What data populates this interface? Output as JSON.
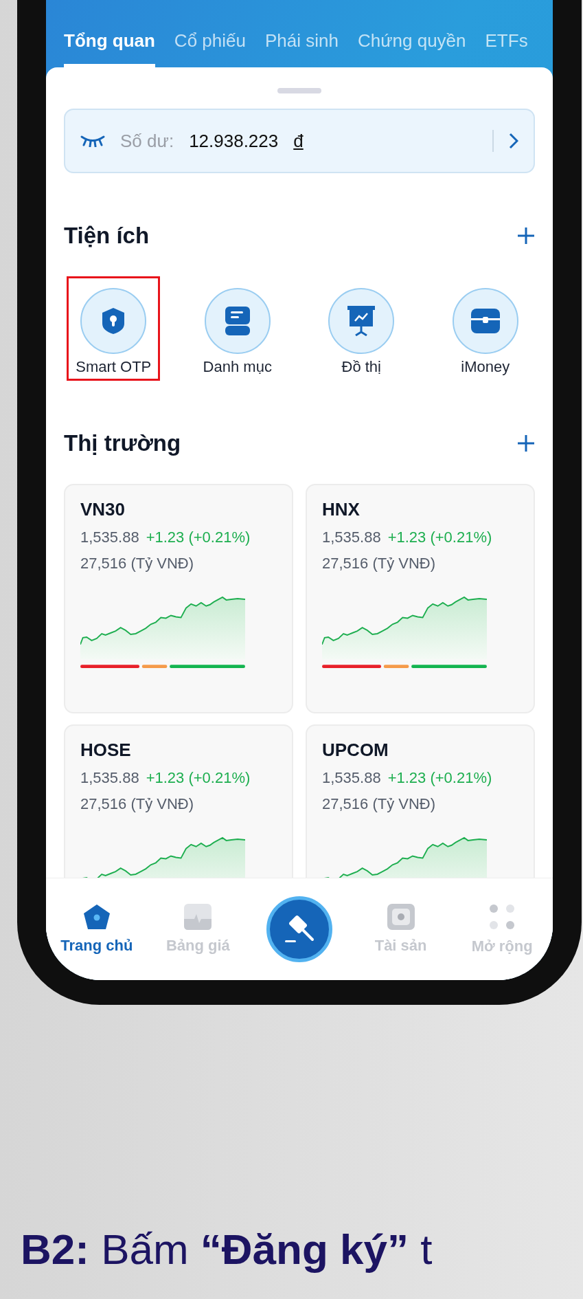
{
  "tabs": [
    {
      "label": "Tổng quan",
      "selected": true
    },
    {
      "label": "Cổ phiếu",
      "selected": false
    },
    {
      "label": "Phái sinh",
      "selected": false
    },
    {
      "label": "Chứng quyền",
      "selected": false
    },
    {
      "label": "ETFs",
      "selected": false
    }
  ],
  "balance": {
    "label": "Số dư:",
    "value": "12.938.223",
    "currency": "đ"
  },
  "utilities": {
    "title": "Tiện ích",
    "items": [
      {
        "label": "Smart OTP",
        "highlighted": true
      },
      {
        "label": "Danh mục",
        "highlighted": false
      },
      {
        "label": "Đồ thị",
        "highlighted": false
      },
      {
        "label": "iMoney",
        "highlighted": false
      }
    ]
  },
  "market": {
    "title": "Thị trường",
    "cards": [
      {
        "name": "VN30",
        "price": "1,535.88",
        "change": "+1.23 (+0.21%)",
        "volume": "27,516 (Tỷ VNĐ)"
      },
      {
        "name": "HNX",
        "price": "1,535.88",
        "change": "+1.23 (+0.21%)",
        "volume": "27,516 (Tỷ VNĐ)"
      },
      {
        "name": "HOSE",
        "price": "1,535.88",
        "change": "+1.23 (+0.21%)",
        "volume": "27,516 (Tỷ VNĐ)"
      },
      {
        "name": "UPCOM",
        "price": "1,535.88",
        "change": "+1.23 (+0.21%)",
        "volume": "27,516 (Tỷ VNĐ)"
      }
    ]
  },
  "bottom_nav": [
    {
      "label": "Trang chủ",
      "selected": true
    },
    {
      "label": "Bảng giá",
      "selected": false
    },
    {
      "kind": "action"
    },
    {
      "label": "Tài sản",
      "selected": false
    },
    {
      "label": "Mở rộng",
      "selected": false
    }
  ],
  "caption": "**B2:** Bấm **“Đăng ký”** t"
}
